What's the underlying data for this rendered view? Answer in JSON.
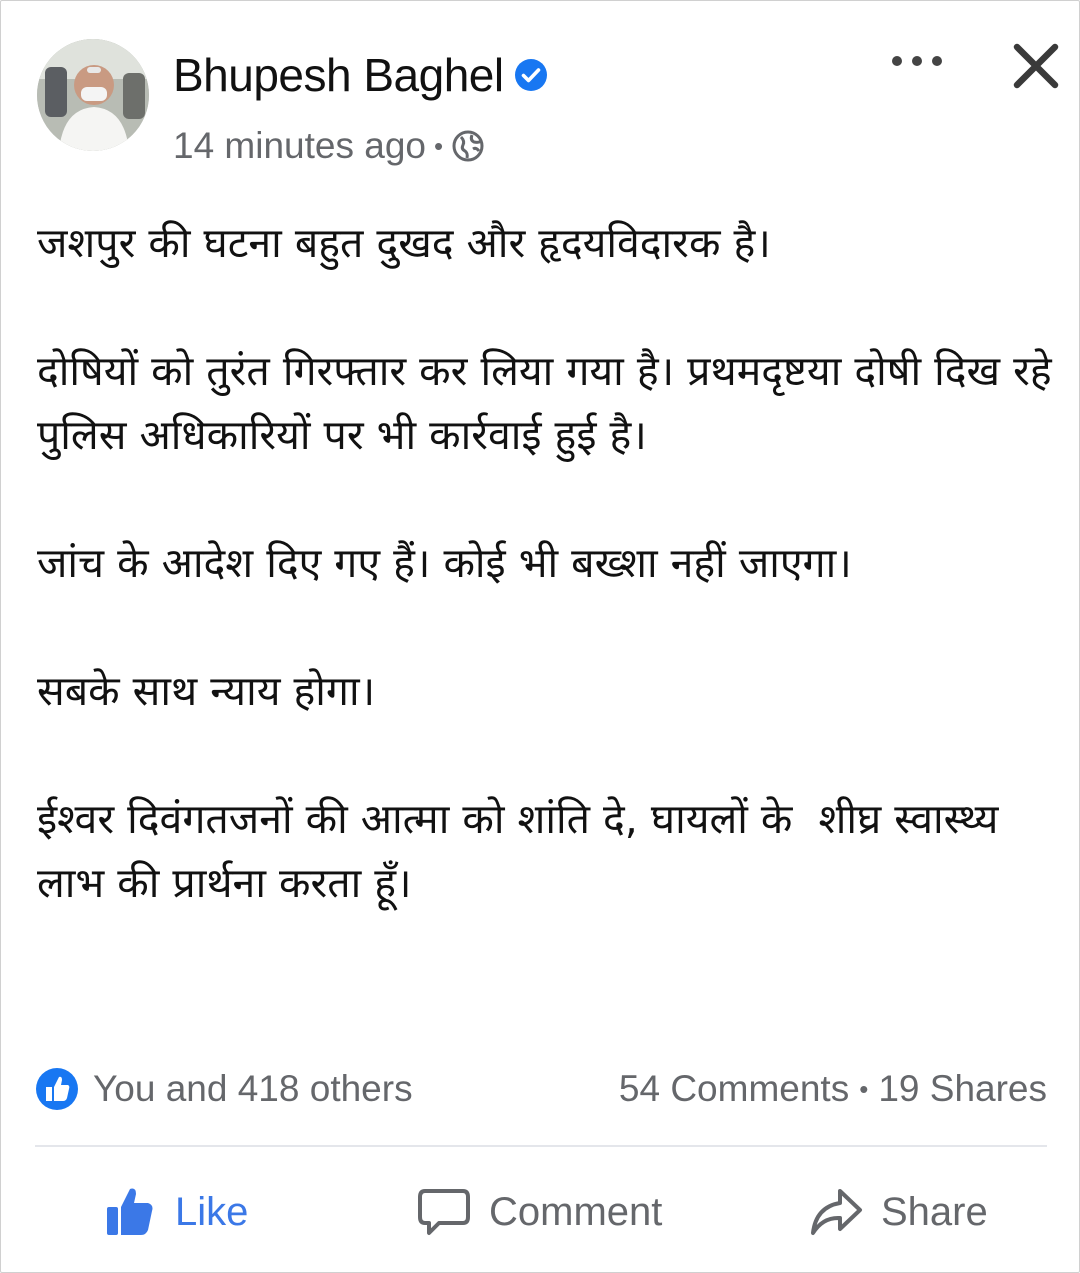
{
  "post": {
    "author": "Bhupesh Baghel",
    "timestamp": "14 minutes ago",
    "meta_separator": "•",
    "privacy_icon": "globe-icon",
    "paragraphs": [
      "जशपुर की घटना बहुत दुखद और हृदयविदारक है।",
      "दोषियों को तुरंत गिरफ्तार कर लिया गया है। प्रथमदृष्टया दोषी दिख रहे पुलिस अधिकारियों पर भी कार्रवाई हुई है।",
      "जांच के आदेश दिए गए हैं। कोई भी बख्शा नहीं जाएगा।",
      "सबके साथ न्याय होगा।",
      "ईश्वर दिवंगतजनों की आत्मा को शांति दे, घायलों के  शीघ्र स्वास्थ्य लाभ की प्रार्थना करता हूँ।"
    ]
  },
  "stats": {
    "likes": "You and 418 others",
    "comments": "54 Comments",
    "separator": "•",
    "shares": "19 Shares"
  },
  "actions": {
    "like": "Like",
    "comment": "Comment",
    "share": "Share"
  },
  "colors": {
    "accent": "#1877f2",
    "like_active": "#3b78e7",
    "muted": "#65676b",
    "text": "#111111",
    "divider": "#e4e6eb"
  }
}
